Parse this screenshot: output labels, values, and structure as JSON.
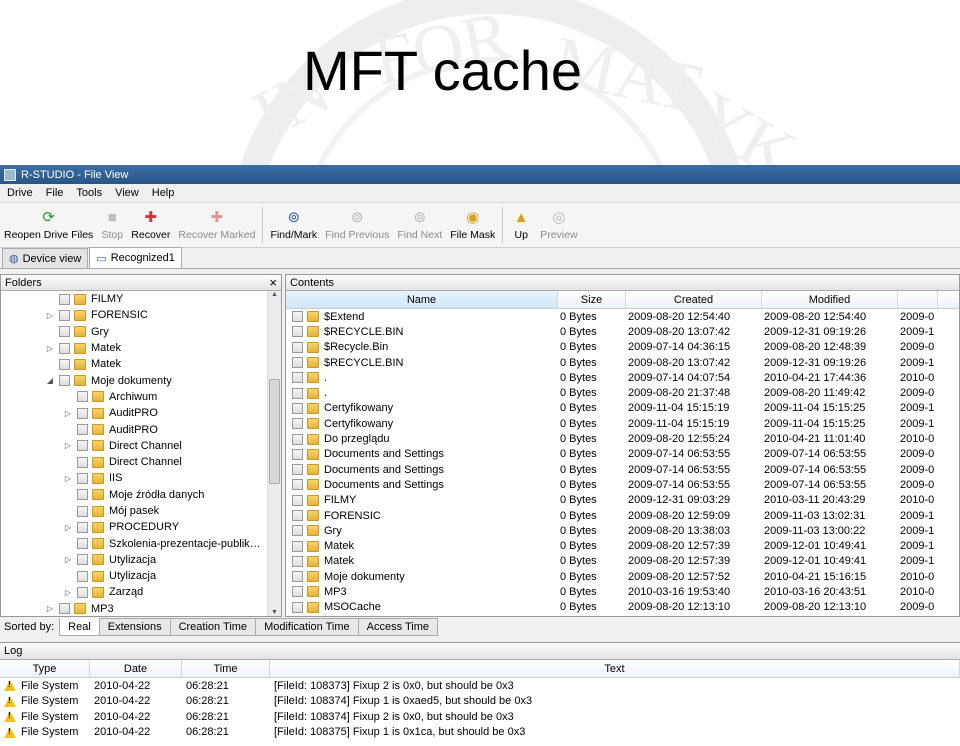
{
  "slide_title": "MFT cache",
  "window": {
    "title": "R-STUDIO - File View"
  },
  "menu": [
    "Drive",
    "File",
    "Tools",
    "View",
    "Help"
  ],
  "toolbar": [
    {
      "label": "Reopen Drive Files",
      "icon": "reopen-icon",
      "enabled": true
    },
    {
      "label": "Stop",
      "icon": "stop-icon",
      "enabled": false
    },
    {
      "label": "Recover",
      "icon": "recover-icon",
      "enabled": true
    },
    {
      "label": "Recover Marked",
      "icon": "recover-marked-icon",
      "enabled": false
    },
    {
      "label": "Find/Mark",
      "icon": "binoculars-icon",
      "enabled": true
    },
    {
      "label": "Find Previous",
      "icon": "find-previous-icon",
      "enabled": false
    },
    {
      "label": "Find Next",
      "icon": "find-next-icon",
      "enabled": false
    },
    {
      "label": "File Mask",
      "icon": "file-mask-icon",
      "enabled": true
    },
    {
      "label": "Up",
      "icon": "folder-up-icon",
      "enabled": true
    },
    {
      "label": "Preview",
      "icon": "preview-icon",
      "enabled": false
    }
  ],
  "tabs": [
    {
      "label": "Device view",
      "active": false
    },
    {
      "label": "Recognized1",
      "active": true
    }
  ],
  "folders": {
    "header": "Folders",
    "close": "×",
    "items": [
      {
        "label": "FILMY",
        "level": 0,
        "expander": ""
      },
      {
        "label": "FORENSIC",
        "level": 0,
        "expander": "▷"
      },
      {
        "label": "Gry",
        "level": 0,
        "expander": ""
      },
      {
        "label": "Matek",
        "level": 0,
        "expander": "▷"
      },
      {
        "label": "Matek",
        "level": 0,
        "expander": ""
      },
      {
        "label": "Moje dokumenty",
        "level": 0,
        "expander": "◢"
      },
      {
        "label": "Archiwum",
        "level": 1,
        "expander": ""
      },
      {
        "label": "AuditPRO",
        "level": 1,
        "expander": "▷"
      },
      {
        "label": "AuditPRO",
        "level": 1,
        "expander": ""
      },
      {
        "label": "Direct Channel",
        "level": 1,
        "expander": "▷"
      },
      {
        "label": "Direct Channel",
        "level": 1,
        "expander": ""
      },
      {
        "label": "IIS",
        "level": 1,
        "expander": "▷"
      },
      {
        "label": "Moje źródła danych",
        "level": 1,
        "expander": ""
      },
      {
        "label": "Mój pasek",
        "level": 1,
        "expander": ""
      },
      {
        "label": "PROCEDURY",
        "level": 1,
        "expander": "▷"
      },
      {
        "label": "Szkolenia-prezentacje-publik…",
        "level": 1,
        "expander": ""
      },
      {
        "label": "Utylizacja",
        "level": 1,
        "expander": "▷"
      },
      {
        "label": "Utylizacja",
        "level": 1,
        "expander": ""
      },
      {
        "label": "Zarząd",
        "level": 1,
        "expander": "▷"
      },
      {
        "label": "MP3",
        "level": 0,
        "expander": "▷"
      }
    ]
  },
  "contents": {
    "header": "Contents",
    "columns": [
      "Name",
      "Size",
      "Created",
      "Modified"
    ],
    "rows": [
      {
        "name": "$Extend",
        "size": "0 Bytes",
        "created": "2009-08-20 12:54:40",
        "modified": "2009-08-20 12:54:40",
        "extra": "2009-0"
      },
      {
        "name": "$RECYCLE.BIN",
        "size": "0 Bytes",
        "created": "2009-08-20 13:07:42",
        "modified": "2009-12-31 09:19:26",
        "extra": "2009-1"
      },
      {
        "name": "$Recycle.Bin",
        "size": "0 Bytes",
        "created": "2009-07-14 04:36:15",
        "modified": "2009-08-20 12:48:39",
        "extra": "2009-0"
      },
      {
        "name": "$RECYCLE.BIN",
        "size": "0 Bytes",
        "created": "2009-08-20 13:07:42",
        "modified": "2009-12-31 09:19:26",
        "extra": "2009-1"
      },
      {
        "name": ".",
        "size": "0 Bytes",
        "created": "2009-07-14 04:07:54",
        "modified": "2010-04-21 17:44:36",
        "extra": "2010-0"
      },
      {
        "name": ".",
        "size": "0 Bytes",
        "created": "2009-08-20 21:37:48",
        "modified": "2009-08-20 11:49:42",
        "extra": "2009-0"
      },
      {
        "name": "Certyfikowany",
        "size": "0 Bytes",
        "created": "2009-11-04 15:15:19",
        "modified": "2009-11-04 15:15:25",
        "extra": "2009-1"
      },
      {
        "name": "Certyfikowany",
        "size": "0 Bytes",
        "created": "2009-11-04 15:15:19",
        "modified": "2009-11-04 15:15:25",
        "extra": "2009-1"
      },
      {
        "name": "Do przeglądu",
        "size": "0 Bytes",
        "created": "2009-08-20 12:55:24",
        "modified": "2010-04-21 11:01:40",
        "extra": "2010-0"
      },
      {
        "name": "Documents and Settings",
        "size": "0 Bytes",
        "created": "2009-07-14 06:53:55",
        "modified": "2009-07-14 06:53:55",
        "extra": "2009-0"
      },
      {
        "name": "Documents and Settings",
        "size": "0 Bytes",
        "created": "2009-07-14 06:53:55",
        "modified": "2009-07-14 06:53:55",
        "extra": "2009-0"
      },
      {
        "name": "Documents and Settings",
        "size": "0 Bytes",
        "created": "2009-07-14 06:53:55",
        "modified": "2009-07-14 06:53:55",
        "extra": "2009-0"
      },
      {
        "name": "FILMY",
        "size": "0 Bytes",
        "created": "2009-12-31 09:03:29",
        "modified": "2010-03-11 20:43:29",
        "extra": "2010-0"
      },
      {
        "name": "FORENSIC",
        "size": "0 Bytes",
        "created": "2009-08-20 12:59:09",
        "modified": "2009-11-03 13:02:31",
        "extra": "2009-1"
      },
      {
        "name": "Gry",
        "size": "0 Bytes",
        "created": "2009-08-20 13:38:03",
        "modified": "2009-11-03 13:00:22",
        "extra": "2009-1"
      },
      {
        "name": "Matek",
        "size": "0 Bytes",
        "created": "2009-08-20 12:57:39",
        "modified": "2009-12-01 10:49:41",
        "extra": "2009-1"
      },
      {
        "name": "Matek",
        "size": "0 Bytes",
        "created": "2009-08-20 12:57:39",
        "modified": "2009-12-01 10:49:41",
        "extra": "2009-1"
      },
      {
        "name": "Moje dokumenty",
        "size": "0 Bytes",
        "created": "2009-08-20 12:57:52",
        "modified": "2010-04-21 15:16:15",
        "extra": "2010-0"
      },
      {
        "name": "MP3",
        "size": "0 Bytes",
        "created": "2010-03-16 19:53:40",
        "modified": "2010-03-16 20:43:51",
        "extra": "2010-0"
      },
      {
        "name": "MSOCache",
        "size": "0 Bytes",
        "created": "2009-08-20 12:13:10",
        "modified": "2009-08-20 12:13:10",
        "extra": "2009-0"
      }
    ]
  },
  "sortbar": {
    "label": "Sorted by:",
    "tabs": [
      "Real",
      "Extensions",
      "Creation Time",
      "Modification Time",
      "Access Time"
    ],
    "active": 0
  },
  "log": {
    "header": "Log",
    "columns": [
      "Type",
      "Date",
      "Time",
      "Text"
    ],
    "rows": [
      {
        "type": "File System",
        "date": "2010-04-22",
        "time": "06:28:21",
        "text": "[FileId: 108373] Fixup 2 is 0x0, but should be 0x3"
      },
      {
        "type": "File System",
        "date": "2010-04-22",
        "time": "06:28:21",
        "text": "[FileId: 108374] Fixup 1 is 0xaed5, but should be 0x3"
      },
      {
        "type": "File System",
        "date": "2010-04-22",
        "time": "06:28:21",
        "text": "[FileId: 108374] Fixup 2 is 0x0, but should be 0x3"
      },
      {
        "type": "File System",
        "date": "2010-04-22",
        "time": "06:28:21",
        "text": "[FileId: 108375] Fixup 1 is 0x1ca, but should be 0x3"
      }
    ]
  }
}
